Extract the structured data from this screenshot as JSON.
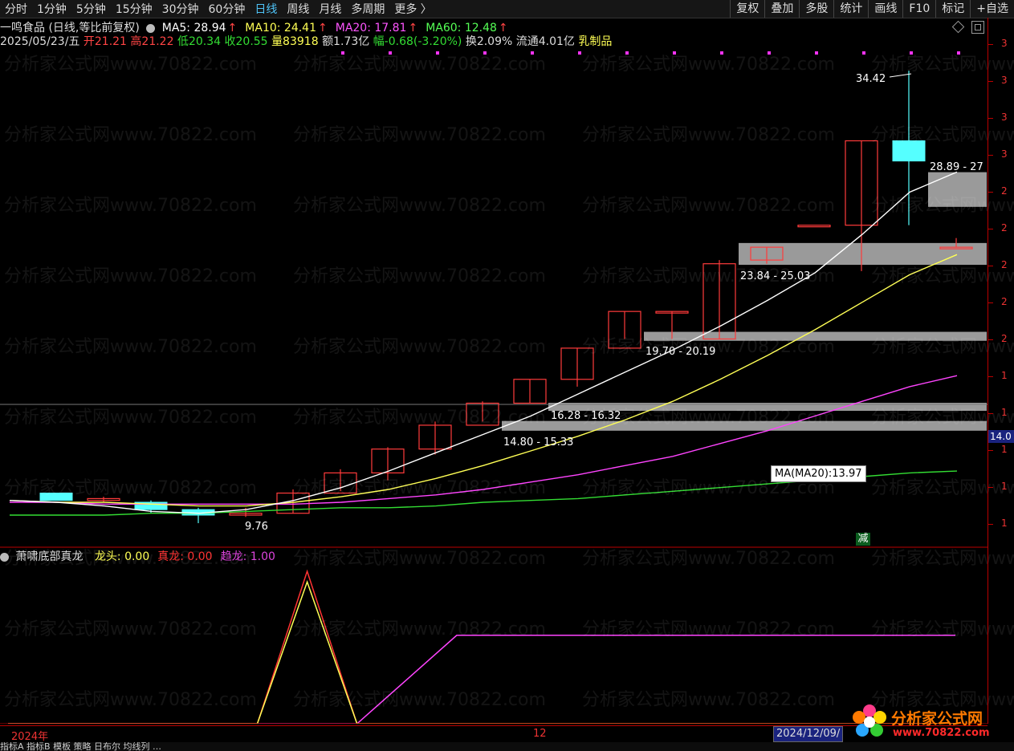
{
  "toolbar": {
    "periods": [
      "分时",
      "1分钟",
      "5分钟",
      "15分钟",
      "30分钟",
      "60分钟",
      "日线",
      "周线",
      "月线",
      "多周期",
      "更多 〉"
    ],
    "active_period": "日线",
    "right_buttons": [
      "复权",
      "叠加",
      "多股",
      "统计",
      "画线",
      "F10",
      "标记",
      "+自选"
    ]
  },
  "header": {
    "stock_name": "一鸣食品",
    "mode": "(日线,等比前复权)",
    "ma": [
      {
        "label": "MA5: 28.94",
        "arrow": "↑",
        "color": "#ffffff"
      },
      {
        "label": "MA10: 24.41",
        "arrow": "↑",
        "color": "#ffff55"
      },
      {
        "label": "MA20: 17.81",
        "arrow": "↑",
        "color": "#ff55ff"
      },
      {
        "label": "MA60: 12.48",
        "arrow": "↑",
        "color": "#55ff55"
      }
    ],
    "date": "2025/05/23/五",
    "open": "开21.21",
    "high": "高21.22",
    "low": "低20.34",
    "close": "收20.55",
    "volume": "量83918",
    "amount": "额1.73亿",
    "change": "幅-0.68(-3.20%)",
    "turnover": "换2.09%",
    "float_cap": "流通4.01亿",
    "sector": "乳制品"
  },
  "indicator": {
    "name": "萧啸底部真龙",
    "items": [
      {
        "label": "龙头: 0.00",
        "color": "#ffff55"
      },
      {
        "label": "真龙: 0.00",
        "color": "#ff3333"
      },
      {
        "label": "趋龙: 1.00",
        "color": "#dd44dd"
      }
    ]
  },
  "right_scale": {
    "labels": [
      "3",
      "3",
      "3",
      "3",
      "2",
      "2",
      "2",
      "2",
      "2",
      "1",
      "1",
      "1",
      "1",
      "1"
    ],
    "price_tag": "14.0"
  },
  "colors": {
    "up": "#ff3b3b",
    "down": "#55ffff",
    "ma5": "#ffffff",
    "ma10": "#ffff55",
    "ma20": "#ff44ff",
    "ma60": "#33dd33",
    "zone": "#9a9a9a"
  },
  "annotations": {
    "high_label": "34.42",
    "low_label": "9.76",
    "ma_box": "MA(MA20):13.97",
    "jian": "减",
    "zones": [
      {
        "label": "28.89 - 27"
      },
      {
        "label": "23.84 - 25.03"
      },
      {
        "label": "19.70 - 20.19"
      },
      {
        "label": "16.28 - 16.32"
      },
      {
        "label": "14.80 - 15.33"
      }
    ]
  },
  "bottom": {
    "year_label": "2024年",
    "month_label": "12",
    "date_box": "2024/12/09/"
  },
  "footer_text": "指标A 指标B 模板 策略 日布尔 均线列 …",
  "logo": {
    "title": "分析家公式网",
    "url": "www.70822.com"
  },
  "watermark": "分析家公式网www.70822.com",
  "chart_data": {
    "type": "candlestick",
    "candles": [
      {
        "o": 11.4,
        "h": 11.4,
        "c": 11.0,
        "l": 11.0
      },
      {
        "o": 11.0,
        "h": 11.2,
        "c": 11.1,
        "l": 10.9
      },
      {
        "o": 10.9,
        "h": 11.0,
        "c": 10.5,
        "l": 10.3
      },
      {
        "o": 10.5,
        "h": 10.6,
        "c": 10.2,
        "l": 9.76
      },
      {
        "o": 10.2,
        "h": 10.6,
        "c": 10.3,
        "l": 10.1
      },
      {
        "o": 10.3,
        "h": 11.6,
        "c": 11.4,
        "l": 10.3
      },
      {
        "o": 11.4,
        "h": 12.7,
        "c": 12.5,
        "l": 11.5
      },
      {
        "o": 12.5,
        "h": 13.9,
        "c": 13.8,
        "l": 12.1
      },
      {
        "o": 13.8,
        "h": 15.3,
        "c": 15.1,
        "l": 13.5
      },
      {
        "o": 15.1,
        "h": 16.4,
        "c": 16.3,
        "l": 15.3
      },
      {
        "o": 16.3,
        "h": 17.6,
        "c": 17.6,
        "l": 16.3
      },
      {
        "o": 17.6,
        "h": 19.3,
        "c": 19.3,
        "l": 17.2
      },
      {
        "o": 19.3,
        "h": 21.3,
        "c": 21.3,
        "l": 19.8
      },
      {
        "o": 21.3,
        "h": 21.3,
        "c": 21.3,
        "l": 19.8
      },
      {
        "o": 19.8,
        "h": 24.1,
        "c": 23.9,
        "l": 19.8
      },
      {
        "o": 24.1,
        "h": 24.8,
        "c": 24.8,
        "l": 23.9
      },
      {
        "o": 26.0,
        "h": 26.0,
        "c": 26.0,
        "l": 26.0
      },
      {
        "o": 26.0,
        "h": 30.6,
        "c": 30.6,
        "l": 23.5
      },
      {
        "o": 30.6,
        "h": 34.42,
        "c": 29.5,
        "l": 26.0
      },
      {
        "o": 24.8,
        "h": 25.3,
        "c": 24.8,
        "l": 24.8
      }
    ],
    "ma5": [
      11.0,
      10.9,
      10.7,
      10.4,
      10.3,
      10.5,
      11.0,
      11.7,
      12.6,
      13.6,
      14.6,
      15.6,
      16.8,
      18.0,
      19.2,
      20.5,
      21.9,
      23.4,
      25.5,
      27.8,
      28.9
    ],
    "ma10": [
      11.0,
      10.9,
      10.9,
      10.8,
      10.7,
      10.7,
      10.9,
      11.2,
      11.6,
      12.2,
      12.9,
      13.7,
      14.5,
      15.4,
      16.4,
      17.6,
      18.9,
      20.3,
      21.8,
      23.3,
      24.4
    ],
    "ma20": [
      10.9,
      10.9,
      10.8,
      10.8,
      10.8,
      10.8,
      10.8,
      10.9,
      11.1,
      11.3,
      11.6,
      12.0,
      12.4,
      12.9,
      13.4,
      14.1,
      14.8,
      15.6,
      16.4,
      17.2,
      17.8
    ],
    "ma60": [
      10.2,
      10.2,
      10.2,
      10.3,
      10.3,
      10.4,
      10.5,
      10.6,
      10.6,
      10.7,
      10.9,
      11.0,
      11.1,
      11.3,
      11.5,
      11.7,
      11.9,
      12.1,
      12.3,
      12.5,
      12.6
    ],
    "zones": [
      [
        27.0,
        28.89
      ],
      [
        23.84,
        25.03
      ],
      [
        19.7,
        20.19
      ],
      [
        16.28,
        16.32
      ],
      [
        14.8,
        15.33
      ]
    ],
    "indicator": {
      "longtou": [
        0,
        0,
        0,
        0,
        0,
        0,
        1,
        0,
        0,
        0,
        0,
        0,
        0,
        0,
        0,
        0,
        0,
        0,
        0,
        0
      ],
      "zhenlong": [
        0,
        0,
        0,
        0,
        0,
        0,
        1,
        0,
        0,
        0,
        0,
        0,
        0,
        0,
        0,
        0,
        0,
        0,
        0,
        0
      ],
      "qulong": [
        0,
        0,
        0,
        0,
        0,
        0,
        0,
        0,
        0.5,
        1,
        1,
        1,
        1,
        1,
        1,
        1,
        1,
        1,
        1,
        1
      ]
    },
    "ylim": [
      9.5,
      36
    ]
  }
}
